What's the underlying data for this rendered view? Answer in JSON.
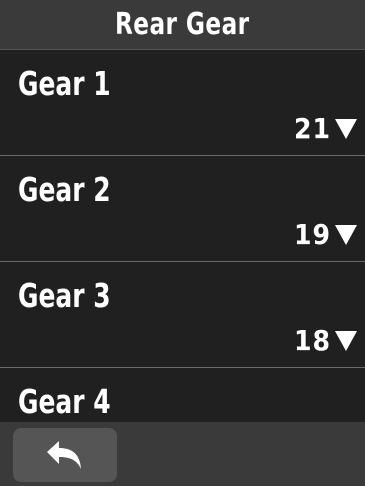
{
  "header": {
    "title": "Rear Gear"
  },
  "gears": [
    {
      "label": "Gear 1",
      "value": "21"
    },
    {
      "label": "Gear 2",
      "value": "19"
    },
    {
      "label": "Gear 3",
      "value": "18"
    },
    {
      "label": "Gear 4",
      "value": ""
    }
  ],
  "footer": {
    "back_icon": "back-arrow-icon"
  },
  "colors": {
    "background": "#202020",
    "header": "#3a3a3a",
    "button": "#555555",
    "text": "#ffffff"
  }
}
